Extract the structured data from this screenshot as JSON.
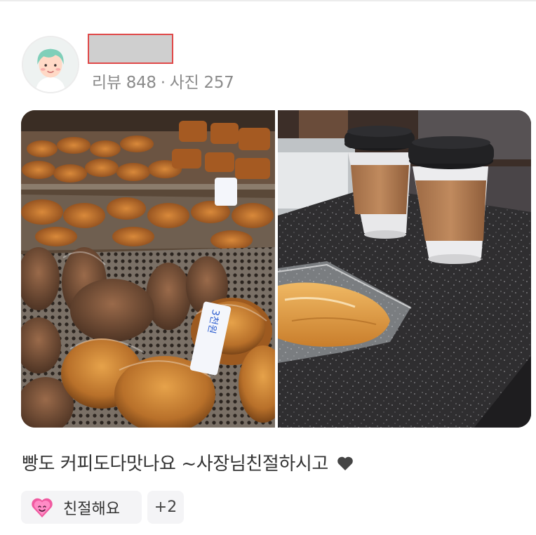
{
  "reviewer": {
    "stats": {
      "reviews": "리뷰 848",
      "separator": "·",
      "photos": "사진 257"
    }
  },
  "review": {
    "text": "빵도 커피도다맛나요 ~사장님친절하시고"
  },
  "photos": {
    "left": {
      "sign_text": "3천원"
    },
    "right": {}
  },
  "tags": [
    {
      "label": "친절해요",
      "icon": "heart-face-icon"
    },
    {
      "label": "+2"
    }
  ],
  "colors": {
    "stats_text": "#8b8b8b",
    "tag_bg": "#f4f4f6",
    "redaction_border": "#e04848"
  }
}
